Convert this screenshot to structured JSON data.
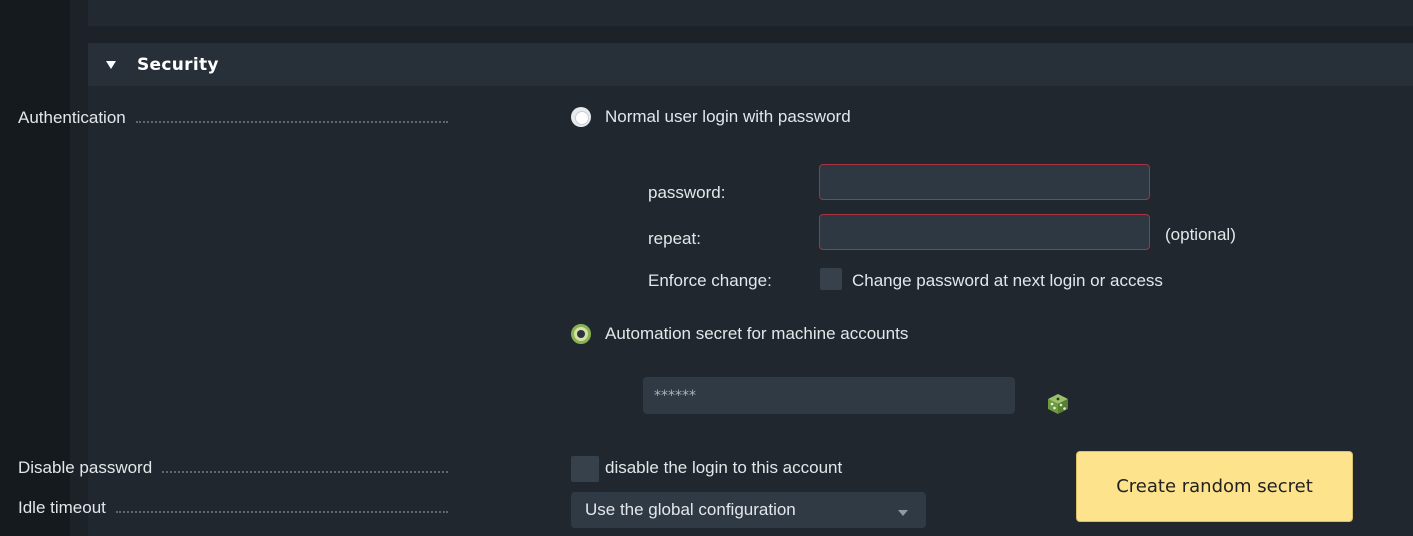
{
  "section": {
    "title": "Security"
  },
  "authentication": {
    "label": "Authentication",
    "option_password": "Normal user login with password",
    "password_label": "password:",
    "repeat_label": "repeat:",
    "optional_text": "(optional)",
    "enforce_label": "Enforce change:",
    "enforce_text": "Change password at next login or access",
    "option_automation": "Automation secret for machine accounts",
    "secret_value": "******"
  },
  "disable_password": {
    "label": "Disable password",
    "checkbox_text": "disable the login to this account"
  },
  "idle_timeout": {
    "label": "Idle timeout",
    "selected": "Use the global configuration"
  },
  "tooltip": {
    "text": "Create random secret"
  },
  "colors": {
    "accent_green": "#8ab153",
    "error_border": "#a8323f",
    "tooltip_bg": "#fce38c"
  },
  "icons": {
    "dice": "dice-icon",
    "toggle": "triangle-down-icon"
  }
}
